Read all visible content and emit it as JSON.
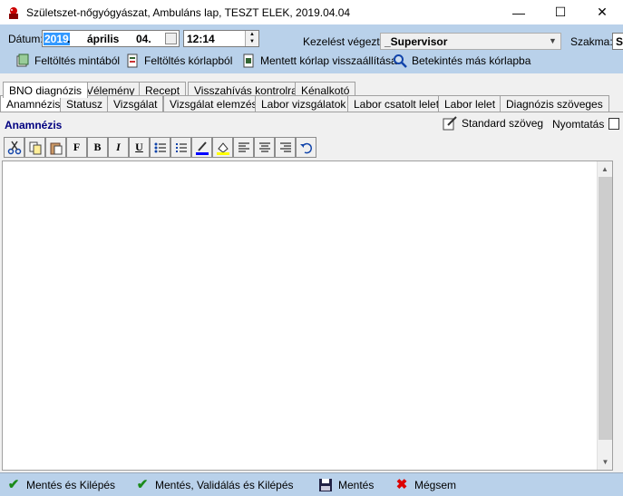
{
  "window": {
    "title": "Születszet-nőgyógyászat, Ambuláns lap, TESZT ELEK, 2019.04.04",
    "minimize": "—",
    "maximize": "☐",
    "close": "✕"
  },
  "form": {
    "date_label": "Dátum:",
    "date_year": "2019",
    "date_dot": ".",
    "date_month": "április",
    "date_day": "04.",
    "time_value": "12:14",
    "kezelest_label": "Kezelést végezte:",
    "kezelest_value": "_Supervisor",
    "szakma_label": "Szakma:",
    "szakma_value": "S"
  },
  "toolbar": {
    "btn1": "Feltöltés mintából",
    "btn2": "Feltöltés kórlapból",
    "btn3": "Mentett kórlap visszaállítása",
    "btn4": "Betekintés más kórlapba"
  },
  "tabs_row1": [
    "BNO diagnózis",
    "Vélemény",
    "Recept",
    "Visszahívás kontrolra",
    "Kénalkotó"
  ],
  "tabs_row2": [
    "Anamnézis",
    "Statusz",
    "Vizsgálat",
    "Vizsgálat elemzés",
    "Labor vizsgálatok",
    "Labor csatolt lelet",
    "Labor lelet",
    "Diagnózis szöveges"
  ],
  "panel": {
    "title": "Anamnézis",
    "standard_text": "Standard szöveg",
    "print": "Nyomtatás"
  },
  "editor_toolbar": {
    "bold": "B",
    "italic": "I",
    "underline": "U",
    "font": "F"
  },
  "bottom": {
    "save_exit": "Mentés és Kilépés",
    "save_validate_exit": "Mentés, Validálás és Kilépés",
    "save": "Mentés",
    "cancel": "Mégsem"
  }
}
